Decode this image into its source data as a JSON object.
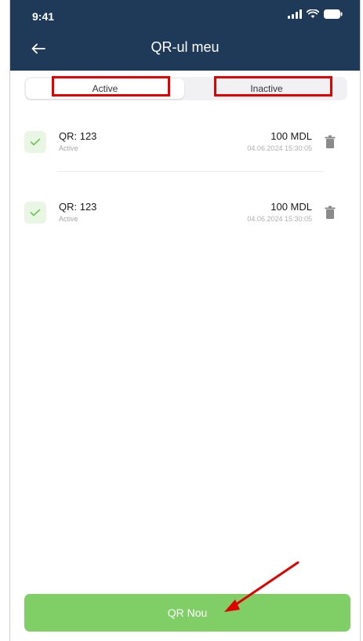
{
  "status_bar": {
    "time": "9:41"
  },
  "header": {
    "title": "QR-ul meu"
  },
  "tabs": [
    {
      "label": "Active",
      "selected": true
    },
    {
      "label": "Inactive",
      "selected": false
    }
  ],
  "items": [
    {
      "qr": "QR: 123",
      "status": "Active",
      "amount": "100 MDL",
      "date": "04.06.2024 15:30:05"
    },
    {
      "qr": "QR: 123",
      "status": "Active",
      "amount": "100 MDL",
      "date": "04.06.2024 15:30:05"
    }
  ],
  "action": {
    "new_qr_label": "QR Nou"
  },
  "icons": {
    "back": "arrow-left-icon",
    "check": "check-icon",
    "trash": "trash-icon",
    "signal": "signal-icon",
    "wifi": "wifi-icon",
    "battery": "battery-icon"
  },
  "colors": {
    "header_bg": "#1f3a58",
    "accent_green": "#7fcf66",
    "check_bg": "#e8f6e3",
    "annotation_red": "#e30000"
  }
}
